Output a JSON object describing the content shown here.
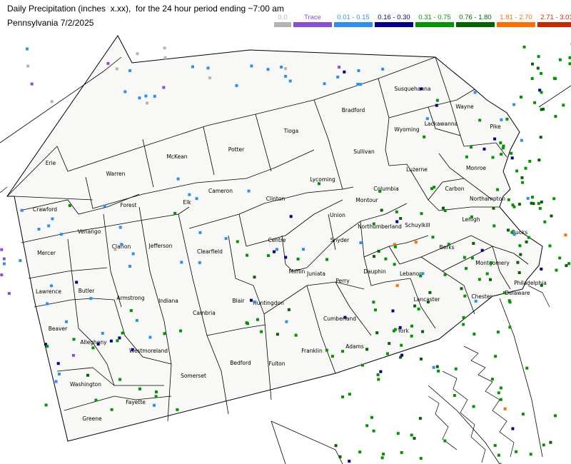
{
  "title": "Daily Precipitation (inches  x.xx),  for the 24 hour period ending ~7:00 am",
  "subtitle": "Pennsylvania 7/2/2025",
  "legend": [
    {
      "label": "0.0",
      "color": "#b4b4b4"
    },
    {
      "label": "Trace",
      "color": "#8a4fd0"
    },
    {
      "label": "0.01 - 0.15",
      "color": "#2f8ff0"
    },
    {
      "label": "0.16 - 0.30",
      "color": "#00008c"
    },
    {
      "label": "0.31 - 0.75",
      "color": "#009600"
    },
    {
      "label": "0.76 - 1.80",
      "color": "#006400"
    },
    {
      "label": "1.81 - 2.70",
      "color": "#ff6e00"
    },
    {
      "label": "2.71 - 3.01",
      "color": "#c82800"
    }
  ],
  "counties": [
    "Erie",
    "Warren",
    "McKean",
    "Potter",
    "Tioga",
    "Bradford",
    "Susquehanna",
    "Wayne",
    "Wyoming",
    "Lackawanna",
    "Pike",
    "Sullivan",
    "Crawford",
    "Forest",
    "Elk",
    "Cameron",
    "Clinton",
    "Lycoming",
    "Luzerne",
    "Monroe",
    "Columbia",
    "Montour",
    "Carbon",
    "Northampton",
    "Venango",
    "Mercer",
    "Clarion",
    "Jefferson",
    "Clearfield",
    "Centre",
    "Union",
    "Northumberland",
    "Schuylkill",
    "Lehigh",
    "Bucks",
    "Lawrence",
    "Butler",
    "Armstrong",
    "Indiana",
    "Snyder",
    "Mifflin",
    "Juniata",
    "Perry",
    "Dauphin",
    "Lebanon",
    "Berks",
    "Montgomery",
    "Philadelphia",
    "Beaver",
    "Allegheny",
    "Cambria",
    "Blair",
    "Huntingdon",
    "Cumberland",
    "Lancaster",
    "Chester",
    "Delaware",
    "York",
    "Westmoreland",
    "Washington",
    "Somerset",
    "Bedford",
    "Fulton",
    "Franklin",
    "Adams",
    "Fayette",
    "Greene"
  ]
}
